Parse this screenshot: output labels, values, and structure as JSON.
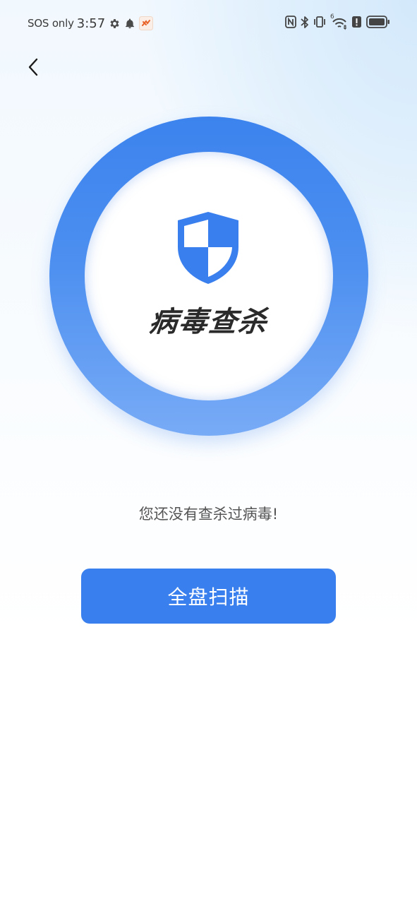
{
  "status_bar": {
    "carrier": "SOS only",
    "time": "3:57",
    "icons_left": [
      "gear-icon",
      "bell-icon",
      "app-notification-icon"
    ],
    "icons_right": [
      "nfc-icon",
      "bluetooth-icon",
      "vibrate-icon",
      "wifi-icon",
      "alert-icon",
      "battery-icon"
    ],
    "wifi_badge": "6"
  },
  "nav": {
    "back_icon": "chevron-left-icon"
  },
  "scan_ring": {
    "icon": "shield-icon",
    "title": "病毒查杀"
  },
  "hint": "您还没有查杀过病毒!",
  "scan_button": {
    "label": "全盘扫描"
  },
  "colors": {
    "primary": "#3a7fee",
    "ring_top": "#3c83ee",
    "ring_bottom": "#78abf6"
  }
}
